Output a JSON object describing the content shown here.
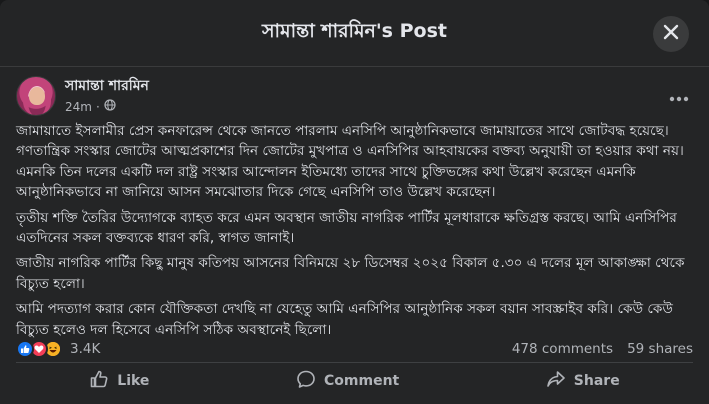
{
  "header": {
    "title": "সামান্তা শারমিন's Post",
    "close_icon": "close-icon"
  },
  "author": {
    "name": "সামান্তা শারমিন",
    "time": "24m",
    "separator": "·",
    "privacy_icon": "globe-icon"
  },
  "post": {
    "paragraphs": [
      "জামায়াতে ইসলামীর প্রেস কনফারেন্স থেকে জানতে পারলাম এনসিপি আনুষ্ঠানিকভাবে জামায়াতের সাথে জোটবদ্ধ হয়েছে। গণতান্ত্রিক সংস্কার জোটের আত্মপ্রকাশের দিন জোটের মুখপাত্র ও এনসিপির আহবায়কের বক্তব্য অনুযায়ী তা হওয়ার কথা নয়। এমনকি তিন দলের একটি দল রাষ্ট্র সংস্কার আন্দোলন ইতিমধ্যে তাদের সাথে চুক্তিভঙ্গের কথা উল্লেখ করেছেন এমনকি আনুষ্ঠানিকভাবে না জানিয়ে আসন সমঝোতার দিকে গেছে এনসিপি তাও উল্লেখ করেছেন।",
      "তৃতীয় শক্তি তৈরির উদ্যোগকে ব্যাহত করে এমন অবস্থান জাতীয় নাগরিক পার্টির মূলধারাকে ক্ষতিগ্রস্ত করছে। আমি এনসিপির এতদিনের সকল বক্তব্যকে ধারণ করি, স্বাগত জানাই।",
      "জাতীয় নাগরিক পার্টির কিছু মানুষ কতিপয় আসনের বিনিময়ে ২৮ ডিসেম্বর ২০২৫ বিকাল ৫.৩০ এ দলের মূল আকাঙ্ক্ষা থেকে বিচ্যুত হলো।",
      "আমি পদত্যাগ করার কোন যৌক্তিকতা দেখছি না যেহেতু আমি এনসিপির আনুষ্ঠানিক সকল বয়ান সাবস্ক্রাইব করি। কেউ কেউ বিচ্যুত হলেও দল হিসেবে এনসিপি সঠিক অবস্থানেই ছিলো।"
    ]
  },
  "stats": {
    "reactions_count": "3.4K",
    "comments": "478 comments",
    "shares": "59 shares",
    "reaction_icons": [
      "like-icon",
      "love-icon",
      "haha-icon"
    ]
  },
  "actions": {
    "like": "Like",
    "comment": "Comment",
    "share": "Share"
  },
  "colors": {
    "background": "#242526",
    "text": "#e4e6eb",
    "secondary": "#b0b3b8",
    "like_blue": "#1877f2",
    "love_red": "#f33e58",
    "haha_yellow": "#f7b125"
  }
}
